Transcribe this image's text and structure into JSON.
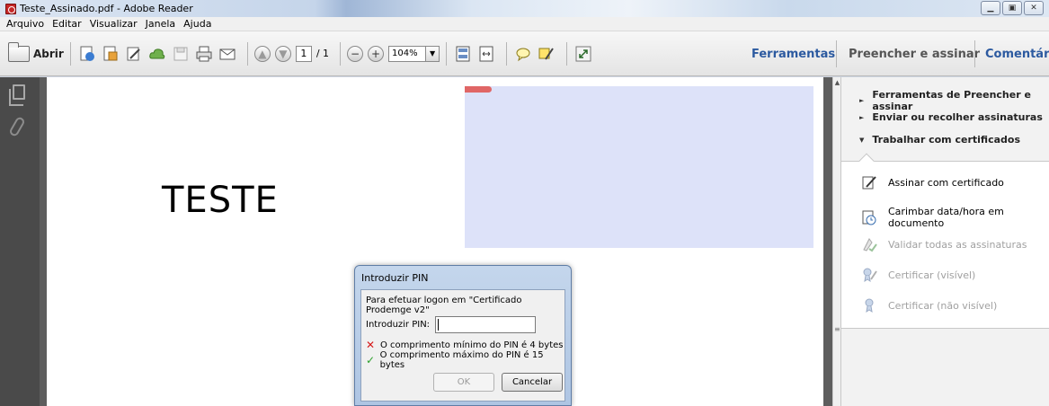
{
  "window": {
    "title": "Teste_Assinado.pdf - Adobe Reader"
  },
  "menu": [
    "Arquivo",
    "Editar",
    "Visualizar",
    "Janela",
    "Ajuda"
  ],
  "toolbar": {
    "open_label": "Abrir",
    "page_current": "1",
    "page_total": "/ 1",
    "zoom": "104%",
    "tabs": {
      "tools": "Ferramentas",
      "fill_sign": "Preencher e assinar",
      "comment": "Comentário"
    }
  },
  "document": {
    "text": "TESTE"
  },
  "right_panel": {
    "sections": [
      "Ferramentas de Preencher e assinar",
      "Enviar ou recolher assinaturas",
      "Trabalhar com certificados"
    ],
    "tools": [
      "Assinar com certificado",
      "Carimbar data/hora em documento",
      "Validar todas as assinaturas",
      "Certificar (visível)",
      "Certificar (não visível)"
    ]
  },
  "dialog": {
    "title": "Introduzir PIN",
    "message": "Para efetuar logon em \"Certificado Prodemge v2\"",
    "pin_label": "Introduzir PIN:",
    "pin_value": "",
    "rule_min": "O comprimento mínimo do PIN é 4 bytes",
    "rule_max": "O comprimento máximo do PIN é 15 bytes",
    "ok_label": "OK",
    "cancel_label": "Cancelar"
  },
  "colors": {
    "tab_active": "#2c5aa0",
    "signature_field": "#dde2f9",
    "error": "#d61a1a",
    "ok": "#2ca02c"
  }
}
